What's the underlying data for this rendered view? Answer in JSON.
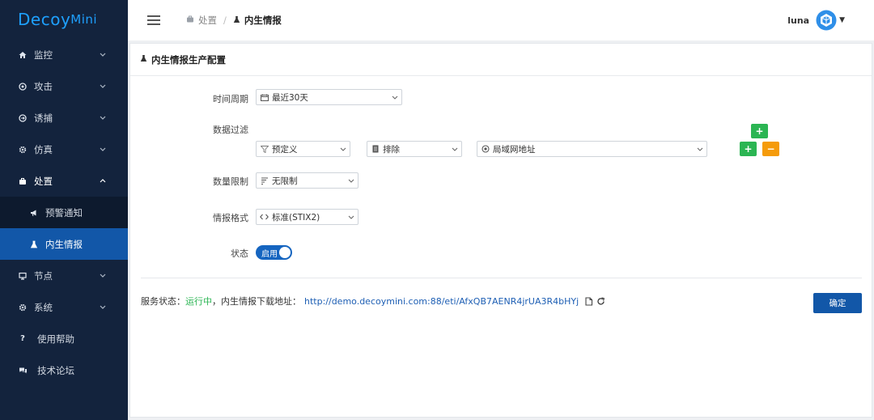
{
  "app": {
    "logo_big": "Decoy",
    "logo_small": "Mini",
    "logo_text": "DecoyMini"
  },
  "sidebar": {
    "items": [
      {
        "label": "监控",
        "icon": "home-icon"
      },
      {
        "label": "攻击",
        "icon": "target-icon"
      },
      {
        "label": "诱捕",
        "icon": "sign-in-icon"
      },
      {
        "label": "仿真",
        "icon": "cog-icon"
      },
      {
        "label": "处置",
        "icon": "briefcase-icon"
      },
      {
        "label": "预警通知",
        "icon": "bullhorn-icon"
      },
      {
        "label": "内生情报",
        "icon": "flask-icon"
      },
      {
        "label": "节点",
        "icon": "monitor-icon"
      },
      {
        "label": "系统",
        "icon": "gear-icon"
      },
      {
        "label": "使用帮助",
        "icon": "question-icon"
      },
      {
        "label": "技术论坛",
        "icon": "comments-icon"
      }
    ]
  },
  "header": {
    "breadcrumb_parent": "处置",
    "breadcrumb_current": "内生情报",
    "username": "luna"
  },
  "panel": {
    "title": "内生情报生产配置",
    "time_period": {
      "label": "时间周期",
      "value": "最近30天"
    },
    "data_filter": {
      "label": "数据过滤",
      "type_value": "预定义",
      "mode_value": "排除",
      "target_value": "局域网地址"
    },
    "quantity": {
      "label": "数量限制",
      "value": "无限制"
    },
    "format": {
      "label": "情报格式",
      "value": "标准(STIX2)"
    },
    "status": {
      "label": "状态",
      "toggle_label": "启用",
      "enabled": true
    },
    "service": {
      "prefix": "服务状态：",
      "running": "运行中",
      "middle": "，内生情报下载地址：",
      "url": "http://demo.decoymini.com:88/eti/AfxQB7AENR4jrUA3R4bHYj"
    },
    "confirm_label": "确定"
  },
  "colors": {
    "sidebar_bg": "#13233d",
    "active_bg": "#1257a8",
    "green": "#2bb553",
    "orange": "#f59b0b",
    "link": "#1e5fb4"
  }
}
